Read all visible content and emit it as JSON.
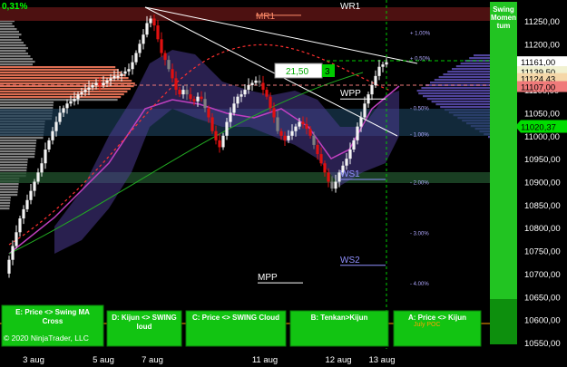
{
  "chart_data": {
    "type": "candlestick",
    "y_ticks": [
      "11250,00",
      "11200,00",
      "11150,00",
      "11100,00",
      "11050,00",
      "11000,00",
      "10950,00",
      "10900,00",
      "10850,00",
      "10800,00",
      "10750,00",
      "10700,00",
      "10650,00",
      "10600,00",
      "10550,00"
    ],
    "ylim": [
      10530,
      11290
    ],
    "x_ticks": [
      "3 aug",
      "5 aug",
      "7 aug",
      "11 aug",
      "12 aug",
      "13 aug"
    ],
    "top_left_label": "0,31%",
    "price_markers": [
      {
        "label": "11161,00",
        "value": 11161,
        "color": "#ffffff",
        "text": "#000000"
      },
      {
        "label": "11139,50",
        "value": 11139.5,
        "color": "#f1f1d0",
        "text": "#000000"
      },
      {
        "label": "11124,43",
        "value": 11124.43,
        "color": "#f5d7a8",
        "text": "#000000"
      },
      {
        "label": "11107,00",
        "value": 11107,
        "color": "#f07a7a",
        "text": "#000000"
      },
      {
        "label": "11020,37",
        "value": 11020.37,
        "color": "#00dd00",
        "text": "#000000"
      }
    ],
    "pivot_levels": [
      {
        "label": "MR1",
        "value": 11262,
        "color": "#ff8c69"
      },
      {
        "label": "WR1",
        "value": 11300,
        "color": "#ffffff"
      },
      {
        "label": "WPP",
        "value": 11080,
        "color": "#ffffff"
      },
      {
        "label": "WS1",
        "value": 10905,
        "color": "#9090ff"
      },
      {
        "label": "WS2",
        "value": 10718,
        "color": "#9090ff"
      },
      {
        "label": "MPP",
        "value": 10680,
        "color": "#ffffff"
      }
    ],
    "percent_labels": [
      {
        "label": "+ 1.00%",
        "value": 11225
      },
      {
        "label": "+ 0.50%",
        "value": 11170
      },
      {
        "label": "- 0.50%",
        "value": 11062
      },
      {
        "label": "- 1.00%",
        "value": 11005
      },
      {
        "label": "- 2.00%",
        "value": 10900
      },
      {
        "label": "- 3.00%",
        "value": 10790
      },
      {
        "label": "- 4.00%",
        "value": 10680
      }
    ],
    "price_box": {
      "value": "21,50",
      "badge": "3"
    },
    "swing_panel_label": "Swing Momentum",
    "bottom_buttons": [
      {
        "label": "E: Price <> Swing MA Cross"
      },
      {
        "label": "D: Kijun <> SWING Cloud"
      },
      {
        "label": "C: Price <> SWING Cloud"
      },
      {
        "label": "B: Tenkan>Kijun"
      },
      {
        "label": "A: Price <> Kijun"
      }
    ],
    "july_poc_label": "July POC",
    "copyright": "© 2020 NinjaTrader, LLC"
  }
}
